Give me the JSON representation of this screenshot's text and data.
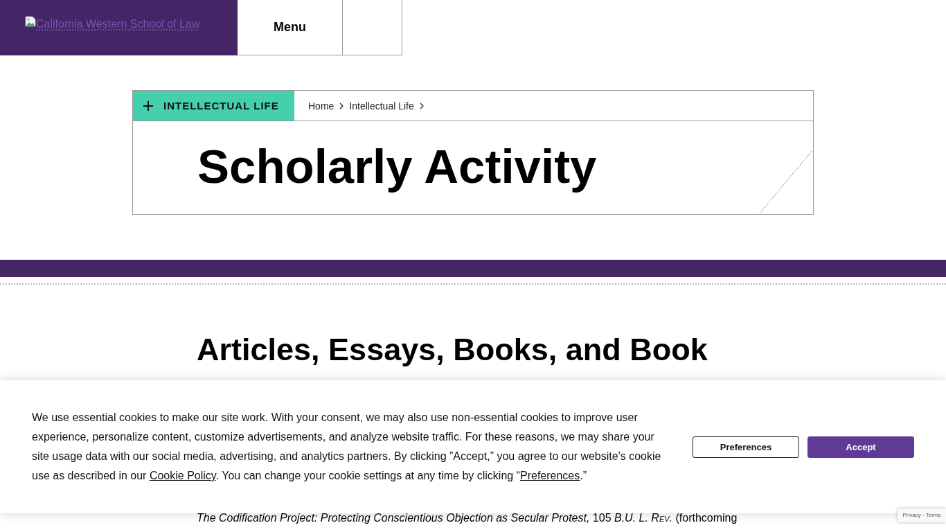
{
  "header": {
    "logo_link": "California Western School of Law",
    "menu_button": "Menu"
  },
  "section_nav": {
    "label": "INTELLECTUAL LIFE",
    "expanded": false
  },
  "breadcrumbs": [
    "Home",
    "Intellectual Life"
  ],
  "page_title": "Scholarly Activity",
  "content": {
    "heading": "Articles, Essays, Books, and Book",
    "citation": "*The Codification Project: Protecting Conscientious Objection as Secular Protest,* 105 *B.U. L. Rev.* (forthcoming"
  },
  "cookie_banner": {
    "message": [
      {
        "kind": "text",
        "text": "We use essential cookies to make our site work. With your consent, we may also use non-essential cookies to improve user experience, personalize content, customize advertisements, and analyze website traffic. For these reasons, we may share your site usage data with our social media, advertising, and analytics partners. By clicking ”Accept,” you agree to our website's cookie use as described in our "
      },
      {
        "kind": "link",
        "text": "Cookie Policy"
      },
      {
        "kind": "text",
        "text": ". You can change your cookie settings at any time by clicking “"
      },
      {
        "kind": "link",
        "text": "Preferences"
      },
      {
        "kind": "text",
        "text": ".”"
      }
    ],
    "buttons": [
      {
        "label": "Preferences",
        "kind": "secondary"
      },
      {
        "label": "Accept",
        "kind": "primary"
      }
    ]
  },
  "recaptcha": {
    "links": "Privacy - Terms"
  }
}
